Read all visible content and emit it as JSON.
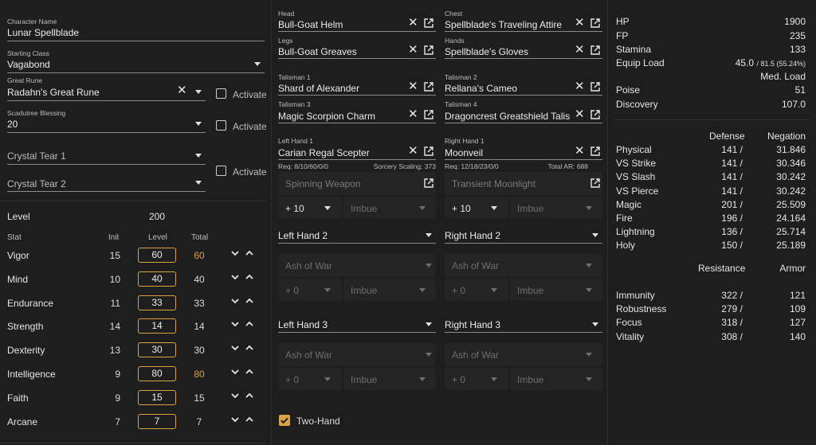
{
  "character": {
    "name_label": "Character Name",
    "name": "Lunar Spellblade",
    "class_label": "Starting Class",
    "class": "Vagabond",
    "rune_label": "Great Rune",
    "rune": "Radahn's Great Rune",
    "rune_activate": "Activate",
    "blessing_label": "Scadutree Blessing",
    "blessing": "20",
    "blessing_activate": "Activate",
    "tear1": "Crystal Tear 1",
    "tear2": "Crystal Tear 2",
    "tears_activate": "Activate"
  },
  "level": {
    "label": "Level",
    "value": "200"
  },
  "stats_header": {
    "stat": "Stat",
    "init": "Init",
    "level": "Level",
    "total": "Total"
  },
  "stats": [
    {
      "name": "Vigor",
      "init": "15",
      "level": "60",
      "total": "60",
      "highlight": true
    },
    {
      "name": "Mind",
      "init": "10",
      "level": "40",
      "total": "40",
      "highlight": false
    },
    {
      "name": "Endurance",
      "init": "11",
      "level": "33",
      "total": "33",
      "highlight": false
    },
    {
      "name": "Strength",
      "init": "14",
      "level": "14",
      "total": "14",
      "highlight": false
    },
    {
      "name": "Dexterity",
      "init": "13",
      "level": "30",
      "total": "30",
      "highlight": false
    },
    {
      "name": "Intelligence",
      "init": "9",
      "level": "80",
      "total": "80",
      "highlight": true
    },
    {
      "name": "Faith",
      "init": "9",
      "level": "15",
      "total": "15",
      "highlight": false
    },
    {
      "name": "Arcane",
      "init": "7",
      "level": "7",
      "total": "7",
      "highlight": false
    }
  ],
  "armor": {
    "head_label": "Head",
    "head": "Bull-Goat Helm",
    "chest_label": "Chest",
    "chest": "Spellblade's Traveling Attire",
    "legs_label": "Legs",
    "legs": "Bull-Goat Greaves",
    "hands_label": "Hands",
    "hands": "Spellblade's Gloves"
  },
  "talismans": {
    "t1_label": "Talisman 1",
    "t1": "Shard of Alexander",
    "t2_label": "Talisman 2",
    "t2": "Rellana's Cameo",
    "t3_label": "Talisman 3",
    "t3": "Magic Scorpion Charm",
    "t4_label": "Talisman 4",
    "t4": "Dragoncrest Greatshield Talisman"
  },
  "weapons": {
    "lh1_label": "Left Hand 1",
    "lh1": "Carian Regal Scepter",
    "lh1_req": "Req: 8/10/60/0/0",
    "lh1_scaling": "Sorcery Scaling: 373",
    "lh1_ash": "Spinning Weapon",
    "lh1_upgrade": "+ 10",
    "lh1_affinity": "Imbue",
    "rh1_label": "Right Hand 1",
    "rh1": "Moonveil",
    "rh1_req": "Req: 12/18/23/0/0",
    "rh1_ar": "Total AR: 688",
    "rh1_ash": "Transient Moonlight",
    "rh1_upgrade": "+ 10",
    "rh1_affinity": "Imbue",
    "lh2": "Left Hand 2",
    "lh2_ash": "Ash of War",
    "lh2_upgrade": "+ 0",
    "lh2_affinity": "Imbue",
    "rh2": "Right Hand 2",
    "rh2_ash": "Ash of War",
    "rh2_upgrade": "+ 0",
    "rh2_affinity": "Imbue",
    "lh3": "Left Hand 3",
    "lh3_ash": "Ash of War",
    "lh3_upgrade": "+ 0",
    "lh3_affinity": "Imbue",
    "rh3": "Right Hand 3",
    "rh3_ash": "Ash of War",
    "rh3_upgrade": "+ 0",
    "rh3_affinity": "Imbue",
    "two_hand": "Two-Hand"
  },
  "summary": {
    "hp_label": "HP",
    "hp": "1900",
    "fp_label": "FP",
    "fp": "235",
    "stamina_label": "Stamina",
    "stamina": "133",
    "equip_label": "Equip Load",
    "equip": "45.0",
    "equip_detail": "/ 81.5 (55.24%)",
    "equip_class": "Med. Load",
    "poise_label": "Poise",
    "poise": "51",
    "discovery_label": "Discovery",
    "discovery": "107.0"
  },
  "defense_header": {
    "defense": "Defense",
    "negation": "Negation"
  },
  "defense": [
    {
      "name": "Physical",
      "defense": "141 /",
      "negation": "31.846"
    },
    {
      "name": "VS Strike",
      "defense": "141 /",
      "negation": "30.346"
    },
    {
      "name": "VS Slash",
      "defense": "141 /",
      "negation": "30.242"
    },
    {
      "name": "VS Pierce",
      "defense": "141 /",
      "negation": "30.242"
    },
    {
      "name": "Magic",
      "defense": "201 /",
      "negation": "25.509"
    },
    {
      "name": "Fire",
      "defense": "196 /",
      "negation": "24.164"
    },
    {
      "name": "Lightning",
      "defense": "136 /",
      "negation": "25.714"
    },
    {
      "name": "Holy",
      "defense": "150 /",
      "negation": "25.189"
    }
  ],
  "resistance_header": {
    "resistance": "Resistance",
    "armor": "Armor"
  },
  "resistance": [
    {
      "name": "Immunity",
      "resistance": "322 /",
      "armor": "121"
    },
    {
      "name": "Robustness",
      "resistance": "279 /",
      "armor": "109"
    },
    {
      "name": "Focus",
      "resistance": "318 /",
      "armor": "127"
    },
    {
      "name": "Vitality",
      "resistance": "308 /",
      "armor": "140"
    }
  ],
  "colors": {
    "accent": "#d9a441",
    "background": "#1e1e1e",
    "text": "#e6e6e6"
  }
}
